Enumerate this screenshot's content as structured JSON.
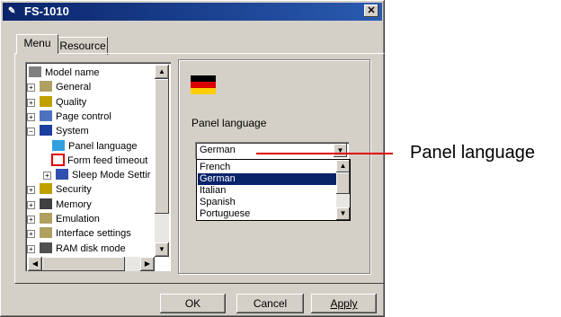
{
  "window": {
    "title": "FS-1010",
    "close_label": "✕"
  },
  "tabs": {
    "menu": "Menu",
    "resource": "Resource"
  },
  "tree": {
    "items": [
      {
        "label": "Model name",
        "icon": "printer-icon",
        "expander": ""
      },
      {
        "label": "General",
        "icon": "stack-icon",
        "expander": "+"
      },
      {
        "label": "Quality",
        "icon": "quality-icon",
        "expander": "+"
      },
      {
        "label": "Page control",
        "icon": "page-icon",
        "expander": "+"
      },
      {
        "label": "System",
        "icon": "floppy-icon",
        "expander": "−"
      },
      {
        "label": "Panel language",
        "icon": "folder-icon",
        "expander": ""
      },
      {
        "label": "Form feed timeout",
        "icon": "clock-icon",
        "expander": ""
      },
      {
        "label": "Sleep Mode Settir",
        "icon": "sleep-icon",
        "expander": "+"
      },
      {
        "label": "Security",
        "icon": "key-icon",
        "expander": "+"
      },
      {
        "label": "Memory",
        "icon": "memory-icon",
        "expander": "+"
      },
      {
        "label": "Emulation",
        "icon": "stack-icon",
        "expander": "+"
      },
      {
        "label": "Interface settings",
        "icon": "stack-icon",
        "expander": "+"
      },
      {
        "label": "RAM disk mode",
        "icon": "disk-icon",
        "expander": "+"
      }
    ]
  },
  "panel": {
    "label": "Panel language",
    "selected": "German",
    "options": [
      "French",
      "German",
      "Italian",
      "Spanish",
      "Portuguese"
    ],
    "flag_colors": [
      "#000000",
      "#dd0000",
      "#ffce00"
    ]
  },
  "buttons": {
    "ok": "OK",
    "cancel": "Cancel",
    "apply": "Apply"
  },
  "callout": {
    "text": "Panel language",
    "color": "#e00000"
  }
}
